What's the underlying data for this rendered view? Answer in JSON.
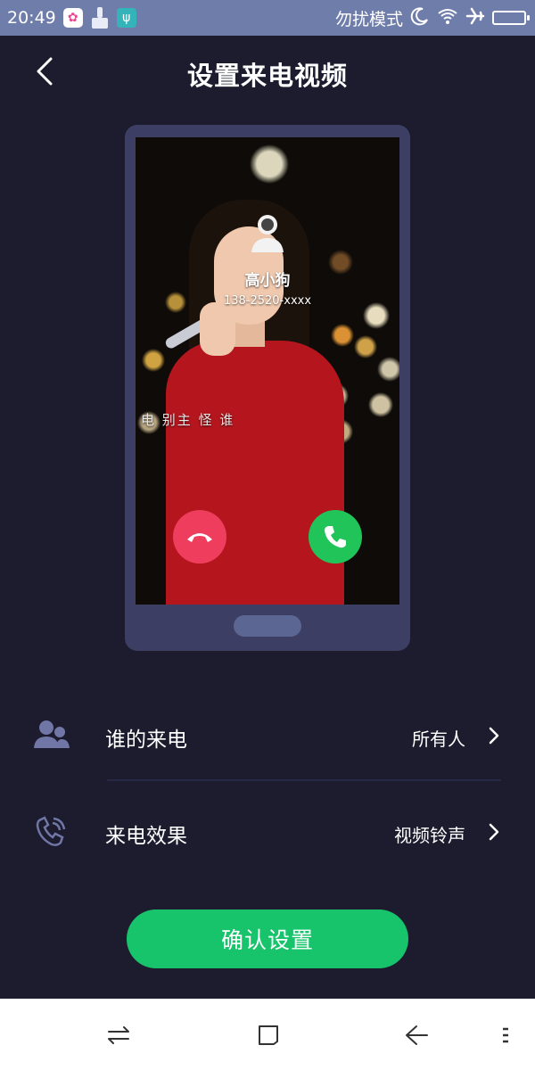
{
  "status_bar": {
    "time": "20:49",
    "dnd_label": "勿扰模式",
    "icons": [
      "gallery-app-icon",
      "brush-icon",
      "usb-icon",
      "moon-icon",
      "wifi-icon",
      "airplane-icon",
      "battery-icon"
    ]
  },
  "header": {
    "title": "设置来电视频",
    "back_icon": "chevron-left-icon"
  },
  "preview": {
    "caller_name": "高小狗",
    "caller_number": "138-2520-xxxx",
    "overlay_text": "电 别主 怪 谁",
    "decline_color": "#ef3d5e",
    "answer_color": "#21c458"
  },
  "settings": {
    "who_calls": {
      "label": "谁的来电",
      "value": "所有人",
      "icon": "people-icon"
    },
    "call_effect": {
      "label": "来电效果",
      "value": "视频铃声",
      "icon": "phone-ring-icon"
    }
  },
  "confirm": {
    "label": "确认设置",
    "color": "#17c46b"
  },
  "nav": {
    "icons": [
      "swap-icon",
      "square-icon",
      "back-arrow-icon",
      "menu-icon"
    ]
  },
  "colors": {
    "background": "#1c1c2e",
    "status_bar": "#6f7dab",
    "phone_frame": "#3c3e64"
  }
}
